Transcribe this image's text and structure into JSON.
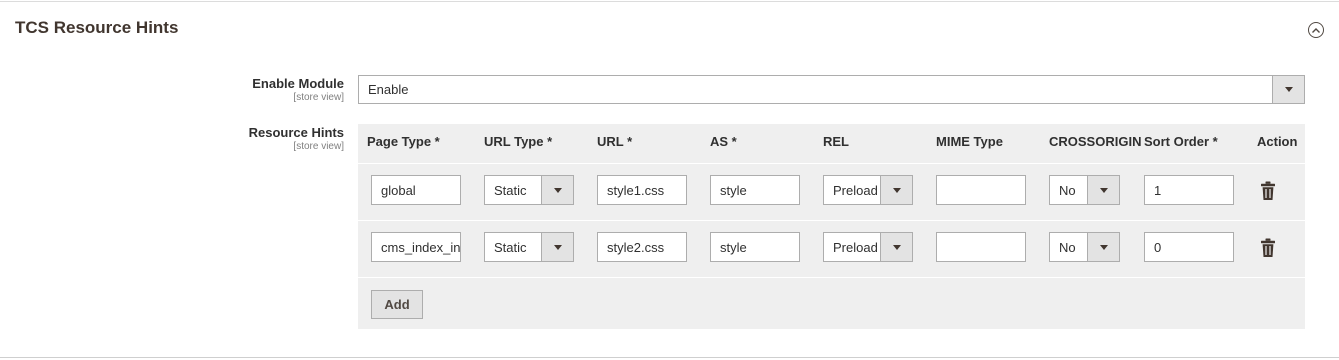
{
  "section": {
    "title": "TCS Resource Hints"
  },
  "enable_module": {
    "label": "Enable Module",
    "scope": "[store view]",
    "value": "Enable"
  },
  "resource_hints": {
    "label": "Resource Hints",
    "scope": "[store view]",
    "columns": [
      "Page Type *",
      "URL Type *",
      "URL *",
      "AS *",
      "REL",
      "MIME Type",
      "CROSSORIGIN",
      "Sort Order *",
      "Action"
    ],
    "rows": [
      {
        "page_type": "global",
        "url_type": "Static",
        "url": "style1.css",
        "as": "style",
        "rel": "Preload",
        "mime_type": "",
        "crossorigin": "No",
        "sort_order": "1"
      },
      {
        "page_type": "cms_index_index",
        "url_type": "Static",
        "url": "style2.css",
        "as": "style",
        "rel": "Preload",
        "mime_type": "",
        "crossorigin": "No",
        "sort_order": "0"
      }
    ],
    "add_label": "Add"
  }
}
